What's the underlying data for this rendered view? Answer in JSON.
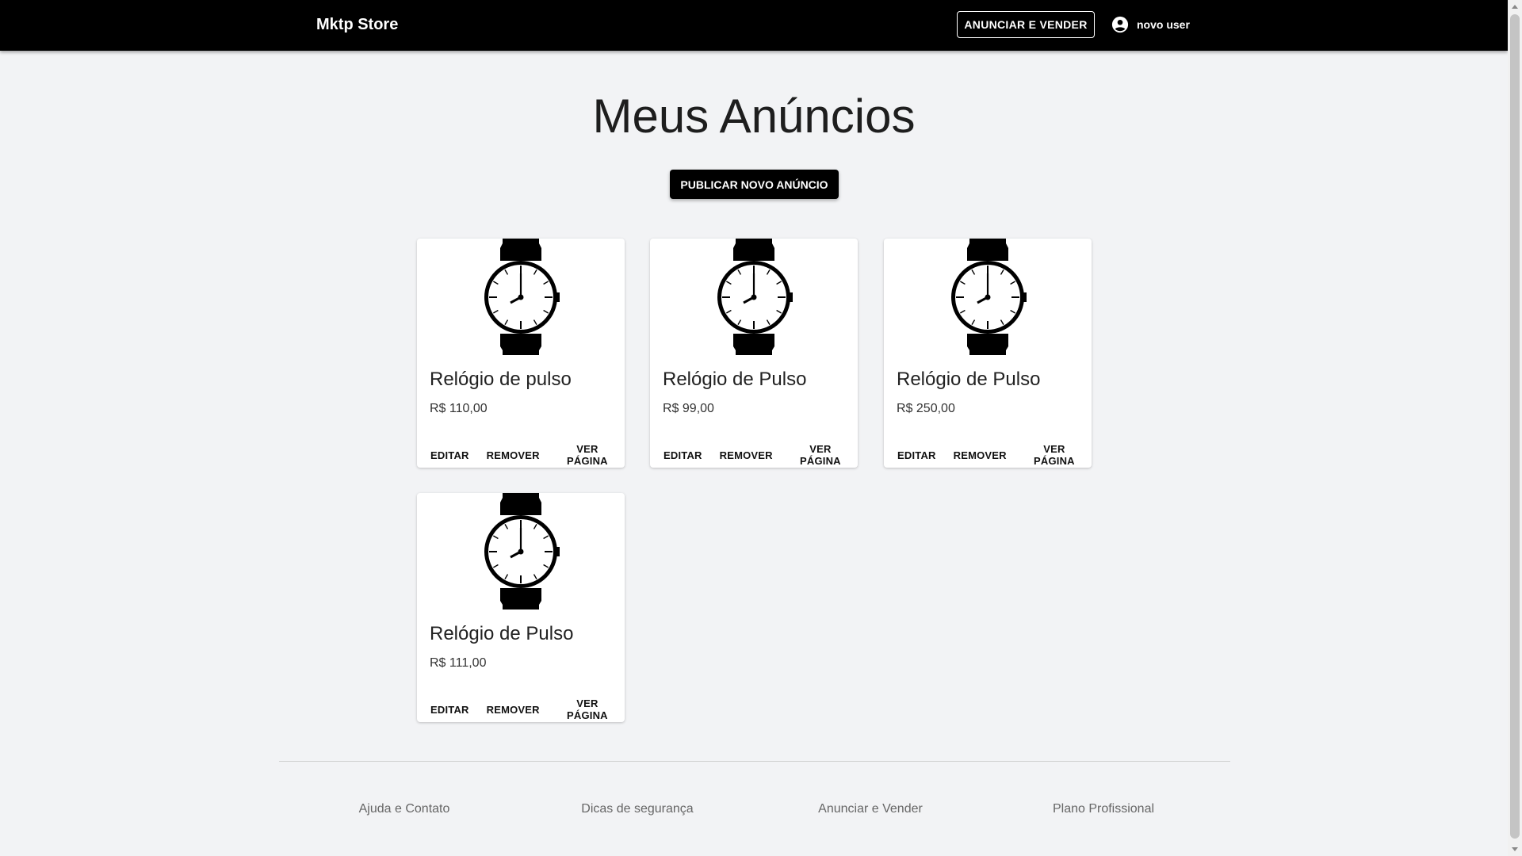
{
  "header": {
    "brand": "Mktp Store",
    "sell_button": "ANUNCIAR E VENDER",
    "user_name": "novo user",
    "user_icon": "account-circle-icon"
  },
  "main": {
    "title": "Meus Anúncios",
    "publish_button": "PUBLICAR NOVO ANÚNCIO",
    "listings": [
      {
        "title": "Relógio de pulso",
        "price": "R$ 110,00",
        "image_icon": "wristwatch-icon",
        "actions": {
          "edit": "EDITAR",
          "remove": "REMOVER",
          "view": "VER PÁGINA"
        }
      },
      {
        "title": "Relógio de Pulso",
        "price": "R$ 99,00",
        "image_icon": "wristwatch-icon",
        "actions": {
          "edit": "EDITAR",
          "remove": "REMOVER",
          "view": "VER PÁGINA"
        }
      },
      {
        "title": "Relógio de Pulso",
        "price": "R$ 250,00",
        "image_icon": "wristwatch-icon",
        "actions": {
          "edit": "EDITAR",
          "remove": "REMOVER",
          "view": "VER PÁGINA"
        }
      },
      {
        "title": "Relógio de Pulso",
        "price": "R$ 111,00",
        "image_icon": "wristwatch-icon",
        "actions": {
          "edit": "EDITAR",
          "remove": "REMOVER",
          "view": "VER PÁGINA"
        }
      }
    ]
  },
  "footer": {
    "links": [
      "Ajuda e Contato",
      "Dicas de segurança",
      "Anunciar e Vender",
      "Plano Profissional"
    ]
  },
  "colors": {
    "header_bg": "#000000",
    "page_bg": "#f2f3f5",
    "card_bg": "#ffffff",
    "primary_button": "#000000"
  }
}
